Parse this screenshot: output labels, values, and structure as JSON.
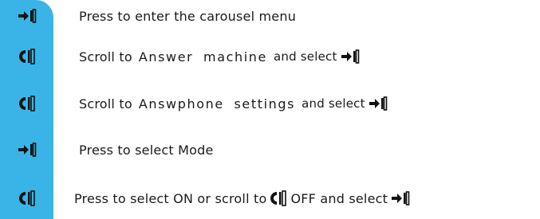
{
  "colors": {
    "sidebar": "#3ab4e6",
    "icon": "#111111"
  },
  "icons": {
    "select": "phone-select-icon",
    "scroll": "scroll-icon"
  },
  "steps": [
    {
      "icon": "select-icon",
      "text": "Press to enter the carousel menu"
    },
    {
      "icon": "scroll-icon",
      "prefix": "Scroll to",
      "target": "Answer  machine",
      "suffix": "and select"
    },
    {
      "icon": "scroll-icon",
      "prefix": "Scroll to",
      "target": "Answphone  settings",
      "suffix": "and select"
    },
    {
      "icon": "select-icon",
      "text": "Press to select Mode"
    },
    {
      "icon": "scroll-icon",
      "prefix": "Press to select ON or scroll to",
      "middle": "OFF and select"
    }
  ]
}
